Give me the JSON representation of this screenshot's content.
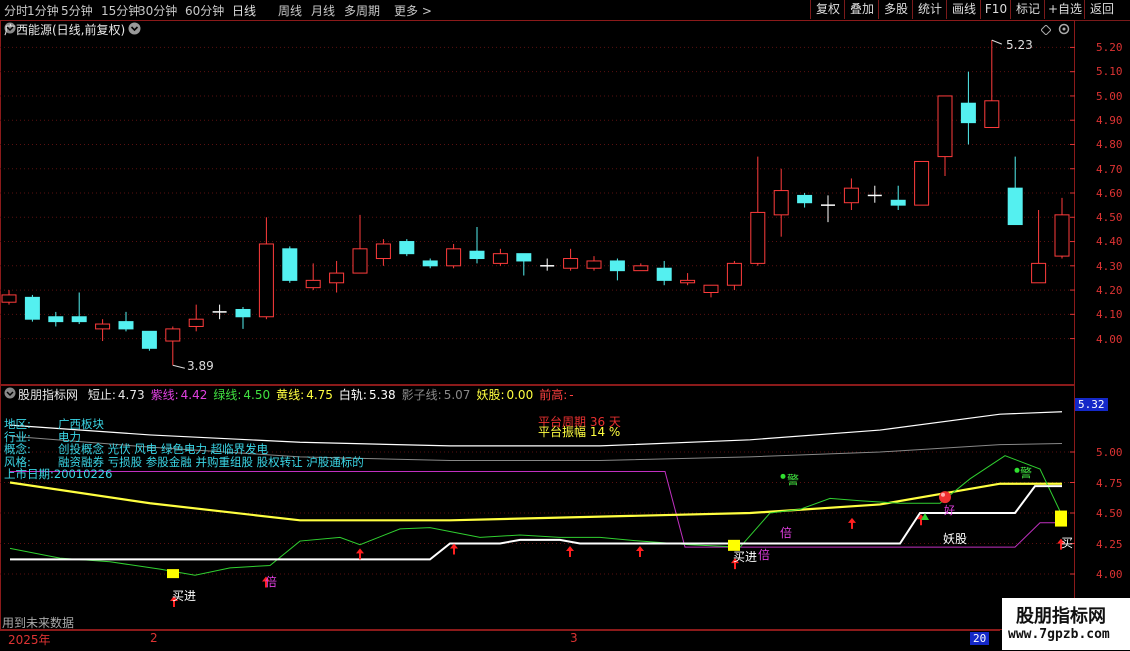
{
  "menu": {
    "periods": [
      "分时",
      "1分钟",
      "5分钟",
      "15分钟",
      "30分钟",
      "60分钟",
      "日线",
      "周线",
      "月线",
      "多周期",
      "更多 >"
    ],
    "active_period": "日线",
    "right_buttons": [
      "复权",
      "叠加",
      "多股",
      "统计",
      "画线",
      "F10",
      "标记",
      "+自选",
      "返回"
    ]
  },
  "main_pane": {
    "title": "广西能源(日线,前复权)",
    "high_marker": "5.23",
    "low_marker": "3.89",
    "price_axis": [
      "5.20",
      "5.10",
      "5.00",
      "4.90",
      "4.80",
      "4.70",
      "4.60",
      "4.50",
      "4.40",
      "4.30",
      "4.20",
      "4.10",
      "4.00"
    ]
  },
  "indicator_pane": {
    "name": "股朋指标网",
    "values": [
      {
        "label": "短止:",
        "value": "4.73",
        "color": "#e8e8e8"
      },
      {
        "label": "紫线:",
        "value": "4.42",
        "color": "#e040e0"
      },
      {
        "label": "绿线:",
        "value": "4.50",
        "color": "#40e040"
      },
      {
        "label": "黄线:",
        "value": "4.75",
        "color": "#ffff40"
      },
      {
        "label": "白轨:",
        "value": "5.38",
        "color": "#ffffff"
      },
      {
        "label": "影子线:",
        "value": "5.07",
        "color": "#888888"
      },
      {
        "label": "妖股:",
        "value": "0.00",
        "color": "#ffff40"
      },
      {
        "label": "前高:",
        "value": "-",
        "color": "#ff4040"
      }
    ],
    "axis": [
      "5.00",
      "4.75",
      "4.50",
      "4.25",
      "4.00"
    ],
    "current_badge": "5.32",
    "info": [
      {
        "key": "地区:",
        "value": "广西板块"
      },
      {
        "key": "行业:",
        "value": "电力"
      },
      {
        "key": "概念:",
        "value": "创投概念 光伏 风电 绿色电力 超临界发电"
      },
      {
        "key": "风格:",
        "value": "融资融券 亏损股 参股金融 并购重组股 股权转让 沪股通标的"
      },
      {
        "key": "上市日期:",
        "value": "20010226"
      }
    ],
    "platform_cycle": "平台周期 36 天",
    "platform_amplitude": "平台振幅 14 %",
    "future_data_note": "用到未来数据",
    "annotations": {
      "buy1": "买进",
      "buy2": "买进",
      "buy3": "买",
      "bei1": "倍",
      "bei2": "倍",
      "bei3": "倍",
      "warn1": "警",
      "warn2": "警",
      "yao": "妖股",
      "hao": "好"
    }
  },
  "date_axis": {
    "year": "2025年",
    "labels": [
      "2",
      "3"
    ],
    "current": "20"
  },
  "watermark": {
    "name": "股朋指标网",
    "url": "www.7gpzb.com"
  },
  "colors": {
    "up": "#ff3c3c",
    "down": "#54f0f0",
    "grid": "#8b1a1a",
    "axis_text": "#dd3333"
  },
  "chart_data": {
    "type": "candlestick",
    "title": "广西能源(日线,前复权)",
    "ylim": [
      3.85,
      5.28
    ],
    "candles": [
      {
        "o": 4.15,
        "c": 4.18,
        "h": 4.2,
        "l": 4.14
      },
      {
        "o": 4.17,
        "c": 4.08,
        "h": 4.18,
        "l": 4.07
      },
      {
        "o": 4.09,
        "c": 4.07,
        "h": 4.11,
        "l": 4.05
      },
      {
        "o": 4.09,
        "c": 4.07,
        "h": 4.19,
        "l": 4.06
      },
      {
        "o": 4.04,
        "c": 4.06,
        "h": 4.08,
        "l": 3.99
      },
      {
        "o": 4.07,
        "c": 4.04,
        "h": 4.11,
        "l": 4.03
      },
      {
        "o": 4.03,
        "c": 3.96,
        "h": 4.03,
        "l": 3.95
      },
      {
        "o": 3.99,
        "c": 4.04,
        "h": 4.05,
        "l": 3.89
      },
      {
        "o": 4.05,
        "c": 4.08,
        "h": 4.14,
        "l": 4.03
      },
      {
        "o": 4.11,
        "c": 4.11,
        "h": 4.14,
        "l": 4.08
      },
      {
        "o": 4.12,
        "c": 4.09,
        "h": 4.13,
        "l": 4.04
      },
      {
        "o": 4.09,
        "c": 4.39,
        "h": 4.5,
        "l": 4.08
      },
      {
        "o": 4.37,
        "c": 4.24,
        "h": 4.38,
        "l": 4.23
      },
      {
        "o": 4.21,
        "c": 4.24,
        "h": 4.31,
        "l": 4.2
      },
      {
        "o": 4.23,
        "c": 4.27,
        "h": 4.32,
        "l": 4.19
      },
      {
        "o": 4.27,
        "c": 4.37,
        "h": 4.51,
        "l": 4.27
      },
      {
        "o": 4.33,
        "c": 4.39,
        "h": 4.41,
        "l": 4.3
      },
      {
        "o": 4.4,
        "c": 4.35,
        "h": 4.41,
        "l": 4.34
      },
      {
        "o": 4.32,
        "c": 4.3,
        "h": 4.33,
        "l": 4.29
      },
      {
        "o": 4.3,
        "c": 4.37,
        "h": 4.39,
        "l": 4.29
      },
      {
        "o": 4.36,
        "c": 4.33,
        "h": 4.46,
        "l": 4.31
      },
      {
        "o": 4.31,
        "c": 4.35,
        "h": 4.37,
        "l": 4.3
      },
      {
        "o": 4.35,
        "c": 4.32,
        "h": 4.35,
        "l": 4.26
      },
      {
        "o": 4.3,
        "c": 4.3,
        "h": 4.33,
        "l": 4.28
      },
      {
        "o": 4.29,
        "c": 4.33,
        "h": 4.37,
        "l": 4.28
      },
      {
        "o": 4.29,
        "c": 4.32,
        "h": 4.34,
        "l": 4.28
      },
      {
        "o": 4.32,
        "c": 4.28,
        "h": 4.33,
        "l": 4.24
      },
      {
        "o": 4.28,
        "c": 4.3,
        "h": 4.31,
        "l": 4.28
      },
      {
        "o": 4.29,
        "c": 4.24,
        "h": 4.32,
        "l": 4.22
      },
      {
        "o": 4.23,
        "c": 4.24,
        "h": 4.27,
        "l": 4.22
      },
      {
        "o": 4.19,
        "c": 4.22,
        "h": 4.22,
        "l": 4.17
      },
      {
        "o": 4.22,
        "c": 4.31,
        "h": 4.32,
        "l": 4.2
      },
      {
        "o": 4.31,
        "c": 4.52,
        "h": 4.75,
        "l": 4.3
      },
      {
        "o": 4.51,
        "c": 4.61,
        "h": 4.7,
        "l": 4.42
      },
      {
        "o": 4.59,
        "c": 4.56,
        "h": 4.6,
        "l": 4.54
      },
      {
        "o": 4.55,
        "c": 4.55,
        "h": 4.59,
        "l": 4.48
      },
      {
        "o": 4.56,
        "c": 4.62,
        "h": 4.66,
        "l": 4.53
      },
      {
        "o": 4.59,
        "c": 4.59,
        "h": 4.63,
        "l": 4.56
      },
      {
        "o": 4.57,
        "c": 4.55,
        "h": 4.63,
        "l": 4.53
      },
      {
        "o": 4.55,
        "c": 4.73,
        "h": 4.73,
        "l": 4.55
      },
      {
        "o": 4.75,
        "c": 5.0,
        "h": 5.0,
        "l": 4.67
      },
      {
        "o": 4.97,
        "c": 4.89,
        "h": 5.1,
        "l": 4.8
      },
      {
        "o": 4.87,
        "c": 4.98,
        "h": 5.23,
        "l": 4.87
      },
      {
        "o": 4.62,
        "c": 4.47,
        "h": 4.75,
        "l": 4.47
      },
      {
        "o": 4.23,
        "c": 4.31,
        "h": 4.53,
        "l": 4.23
      },
      {
        "o": 4.34,
        "c": 4.51,
        "h": 4.58,
        "l": 4.33
      }
    ]
  }
}
